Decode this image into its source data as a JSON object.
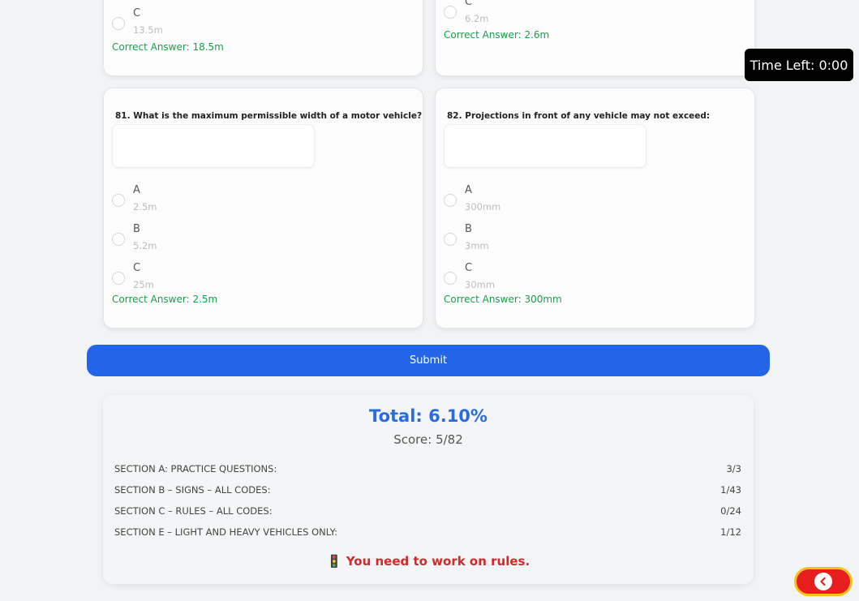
{
  "top_cards": {
    "left": {
      "option_c_letter": "C",
      "option_c_value": "13.5m",
      "correct": "Correct Answer: 18.5m"
    },
    "right": {
      "option_c_letter": "C",
      "option_c_value": "6.2m",
      "correct": "Correct Answer: 2.6m"
    }
  },
  "timer": {
    "label": "Time Left: 0:00"
  },
  "questions": [
    {
      "title": "81. What is the maximum permissible width of a motor vehicle?",
      "options": [
        {
          "letter": "A",
          "value": "2.5m"
        },
        {
          "letter": "B",
          "value": "5.2m"
        },
        {
          "letter": "C",
          "value": "25m"
        }
      ],
      "correct": "Correct Answer: 2.5m"
    },
    {
      "title": "82. Projections in front of any vehicle may not exceed:",
      "options": [
        {
          "letter": "A",
          "value": "300mm"
        },
        {
          "letter": "B",
          "value": "3mm"
        },
        {
          "letter": "C",
          "value": "30mm"
        }
      ],
      "correct": "Correct Answer: 300mm"
    }
  ],
  "submit": {
    "label": "Submit"
  },
  "results": {
    "total": "Total: 6.10%",
    "score": "Score: 5/82",
    "sections": [
      {
        "label": "SECTION A: PRACTICE QUESTIONS:",
        "score": "3/3"
      },
      {
        "label": "SECTION B – SIGNS – ALL CODES:",
        "score": "1/43"
      },
      {
        "label": "SECTION C – RULES – ALL CODES:",
        "score": "0/24"
      },
      {
        "label": "SECTION E – LIGHT AND HEAVY VEHICLES ONLY:",
        "score": "1/12"
      }
    ],
    "advice_icon": "🚦",
    "advice": "You need to work on rules."
  },
  "icons": {
    "back": "chevron-left-icon",
    "traffic": "traffic-light-icon"
  },
  "colors": {
    "accent": "#2265e8",
    "correct": "#18a04a",
    "warning": "#d62828",
    "back_button": "#e81e1e"
  }
}
